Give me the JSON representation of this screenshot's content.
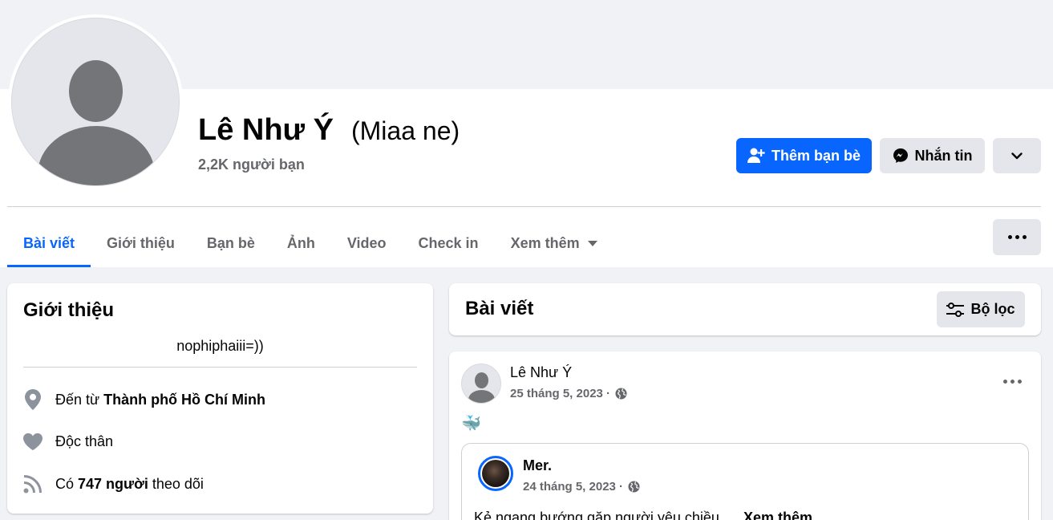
{
  "profile": {
    "name": "Lê Như Ý",
    "alt_name": "(Miaa ne)",
    "friends_count": "2,2K người bạn"
  },
  "actions": {
    "add_friend": "Thêm bạn bè",
    "message": "Nhắn tin"
  },
  "tabs": [
    {
      "label": "Bài viết",
      "active": true
    },
    {
      "label": "Giới thiệu"
    },
    {
      "label": "Bạn bè"
    },
    {
      "label": "Ảnh"
    },
    {
      "label": "Video"
    },
    {
      "label": "Check in"
    },
    {
      "label": "Xem thêm"
    }
  ],
  "intro": {
    "title": "Giới thiệu",
    "bio": "nophiphaiii=))",
    "hometown_prefix": "Đến từ ",
    "hometown": "Thành phố Hồ Chí Minh",
    "relationship": "Độc thân",
    "followers_prefix": "Có ",
    "followers_count": "747 người",
    "followers_suffix": " theo dõi"
  },
  "posts": {
    "title": "Bài viết",
    "filter_label": "Bộ lọc",
    "post": {
      "author": "Lê Như Ý",
      "date": "25 tháng 5, 2023 ·",
      "emoji": "🐳",
      "shared": {
        "author": "Mer.",
        "date": "24 tháng 5, 2023 ·",
        "text": "Kẻ ngang bướng gặp người yêu chiều",
        "see_more": "Xem thêm"
      }
    }
  },
  "colors": {
    "accent": "#0866ff",
    "secondary_text": "#65676b",
    "background": "#f0f2f5"
  }
}
